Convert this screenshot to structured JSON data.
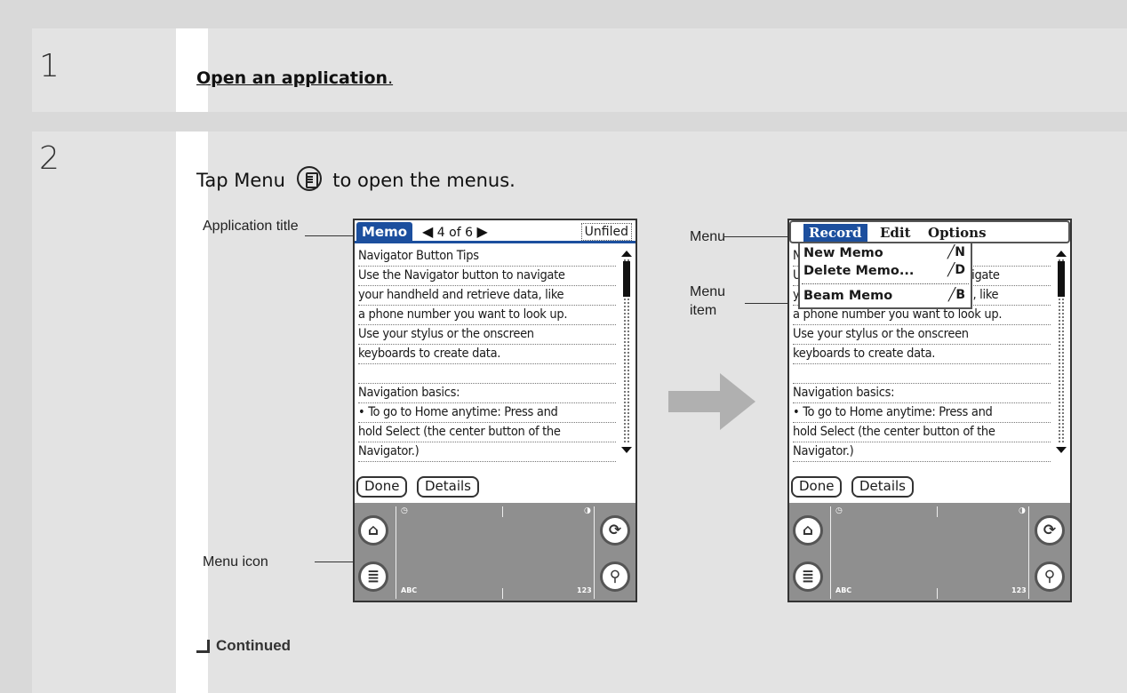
{
  "steps": [
    {
      "number": "1",
      "text": "Open an application",
      "suffix": "."
    },
    {
      "number": "2",
      "text_before": "Tap Menu",
      "text_after": "to open the menus."
    }
  ],
  "callouts": {
    "application_title": "Application title",
    "menu_icon": "Menu icon",
    "menu": "Menu",
    "menu_item": "Menu item"
  },
  "device": {
    "app_title": "Memo",
    "record_position": "4 of 6",
    "category": "Unfiled",
    "lines": [
      "Navigator Button Tips",
      "Use the Navigator button to navigate",
      "your handheld and retrieve data, like",
      "a phone number you want to look up.",
      "Use your stylus or the onscreen",
      "keyboards to create data.",
      "",
      "Navigation basics:",
      "• To go to Home anytime: Press and",
      "hold Select (the center button of the",
      "Navigator.)"
    ],
    "done_button": "Done",
    "details_button": "Details",
    "abc_label": "ABC",
    "num_label": "123"
  },
  "menu": {
    "items": [
      "Record",
      "Edit",
      "Options"
    ],
    "record_items": [
      {
        "label": "New Memo",
        "shortcut": "N"
      },
      {
        "label": "Delete Memo...",
        "shortcut": "D"
      },
      {
        "label": "Beam Memo",
        "shortcut": "B"
      }
    ]
  },
  "continued_label": "Continued"
}
